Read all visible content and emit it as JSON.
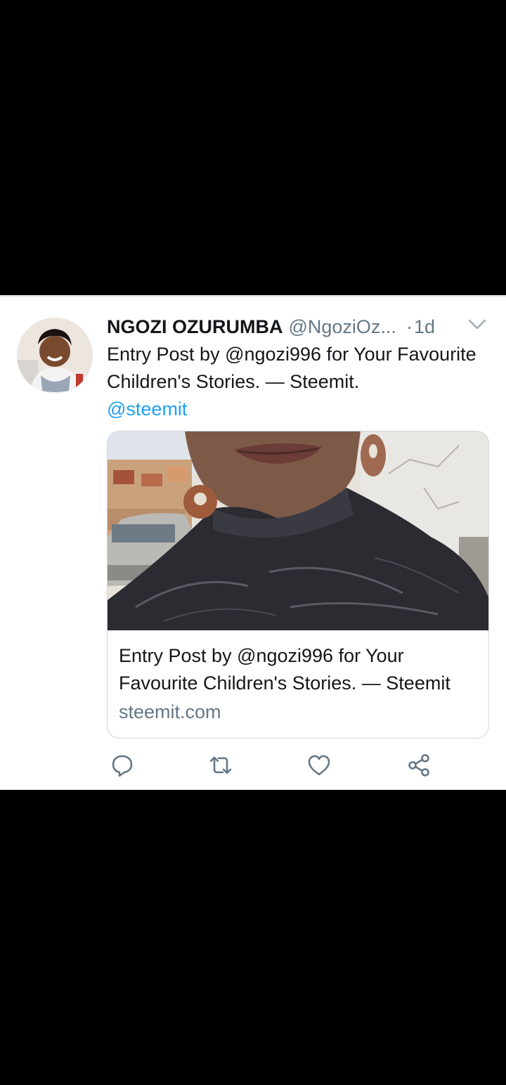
{
  "tweet": {
    "author_name": "NGOZI OZURUMBA",
    "handle": "@NgoziOz...",
    "separator": "·",
    "time": "1d",
    "text_line": "Entry Post by @ngozi996 for Your Favourite Children's  Stories. — Steemit.",
    "mention": "@steemit"
  },
  "card": {
    "title": "Entry Post by @ngozi996 for Your Favourite Children's Stories. — Steemit",
    "domain": "steemit.com"
  },
  "icons": {
    "reply": "reply-icon",
    "retweet": "retweet-icon",
    "like": "heart-icon",
    "share": "share-icon",
    "caret": "chevron-down-icon"
  },
  "colors": {
    "link": "#1da1f2",
    "secondary_text": "#657786",
    "primary_text": "#14171a"
  }
}
